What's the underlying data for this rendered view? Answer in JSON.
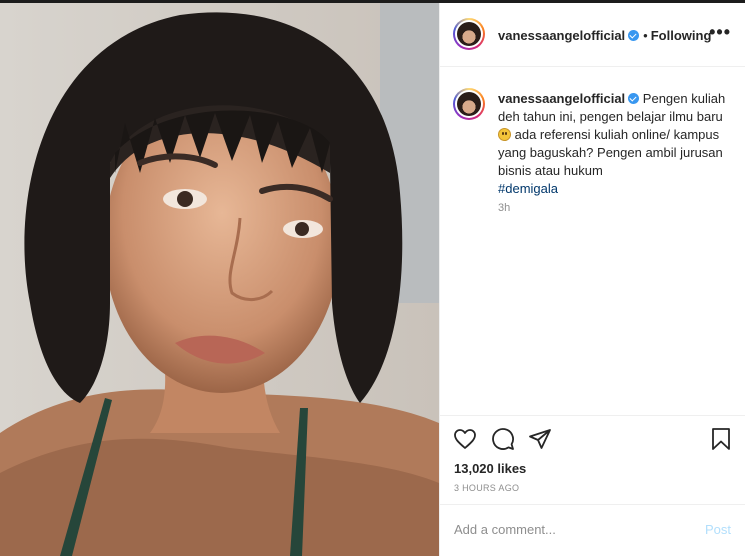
{
  "post": {
    "author": {
      "username": "vanessaangelofficial",
      "verified": true,
      "follow_status": "Following"
    },
    "more_label": "•••",
    "caption": {
      "text": "Pengen kuliah deh tahun ini, pengen belajar ilmu baru",
      "text_after_emoji": "ada referensi kuliah online/ kampus yang baguskah? Pengen ambil jurusan bisnis atau hukum",
      "hashtag": "#demigala",
      "time": "3h"
    },
    "likes": "13,020 likes",
    "posted_ago": "3 HOURS AGO",
    "comment": {
      "placeholder": "Add a comment...",
      "post_label": "Post"
    }
  },
  "icons": [
    "heart-icon",
    "comment-icon",
    "share-icon",
    "bookmark-icon",
    "verified-icon",
    "more-icon"
  ],
  "colors": {
    "accent_blue": "#3897f0",
    "hashtag": "#00376b",
    "post_disabled": "#b2dffc",
    "muted": "#8e8e8e"
  }
}
